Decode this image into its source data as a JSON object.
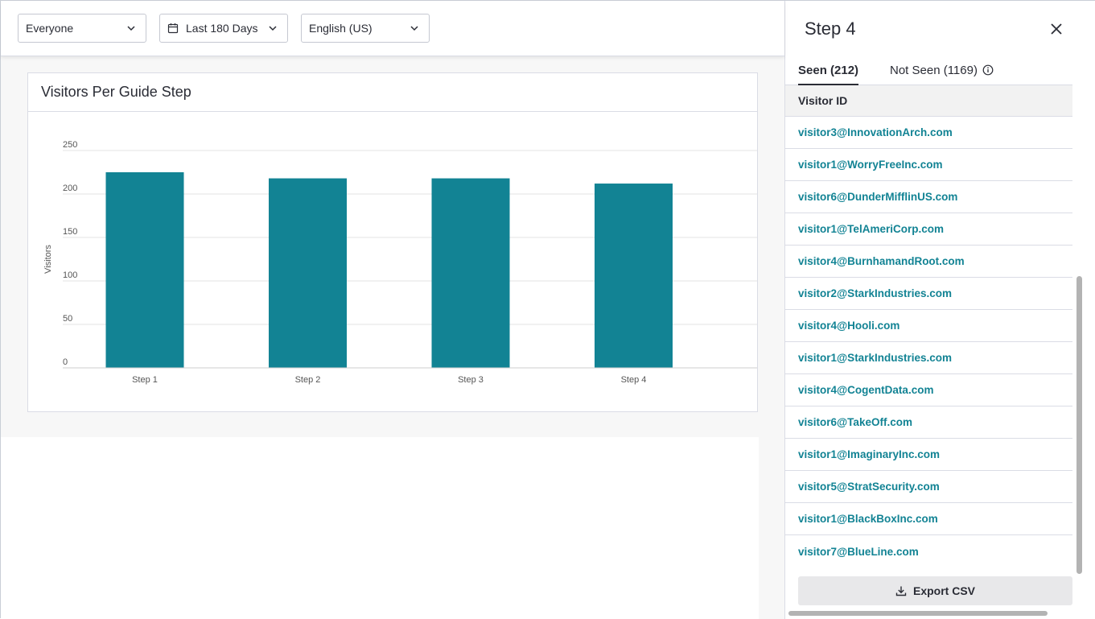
{
  "filters": {
    "segment": "Everyone",
    "date_range": "Last 180 Days",
    "language": "English (US)"
  },
  "card": {
    "title": "Visitors Per Guide Step"
  },
  "chart_data": {
    "type": "bar",
    "categories": [
      "Step 1",
      "Step 2",
      "Step 3",
      "Step 4"
    ],
    "values": [
      225,
      218,
      218,
      212
    ],
    "ylabel": "Visitors",
    "xlabel": "",
    "ylim": [
      0,
      250
    ],
    "yticks": [
      0,
      50,
      100,
      150,
      200,
      250
    ],
    "grid": true,
    "bar_color": "#128394"
  },
  "panel": {
    "title": "Step 4",
    "tabs": [
      {
        "label": "Seen (212)",
        "active": true
      },
      {
        "label": "Not Seen (1169)",
        "active": false
      }
    ],
    "column_header": "Visitor ID",
    "visitors": [
      "visitor3@InnovationArch.com",
      "visitor1@WorryFreeInc.com",
      "visitor6@DunderMifflinUS.com",
      "visitor1@TelAmeriCorp.com",
      "visitor4@BurnhamandRoot.com",
      "visitor2@StarkIndustries.com",
      "visitor4@Hooli.com",
      "visitor1@StarkIndustries.com",
      "visitor4@CogentData.com",
      "visitor6@TakeOff.com",
      "visitor1@ImaginaryInc.com",
      "visitor5@StratSecurity.com",
      "visitor1@BlackBoxInc.com",
      "visitor7@BlueLine.com"
    ],
    "export_label": "Export CSV"
  },
  "colors": {
    "accent": "#128394",
    "text": "#2a2c35",
    "border": "#dadce5"
  },
  "icons": {
    "dropdown": "chevron-down-icon",
    "calendar": "calendar-icon",
    "close": "close-icon",
    "info": "info-icon",
    "download": "download-icon"
  }
}
